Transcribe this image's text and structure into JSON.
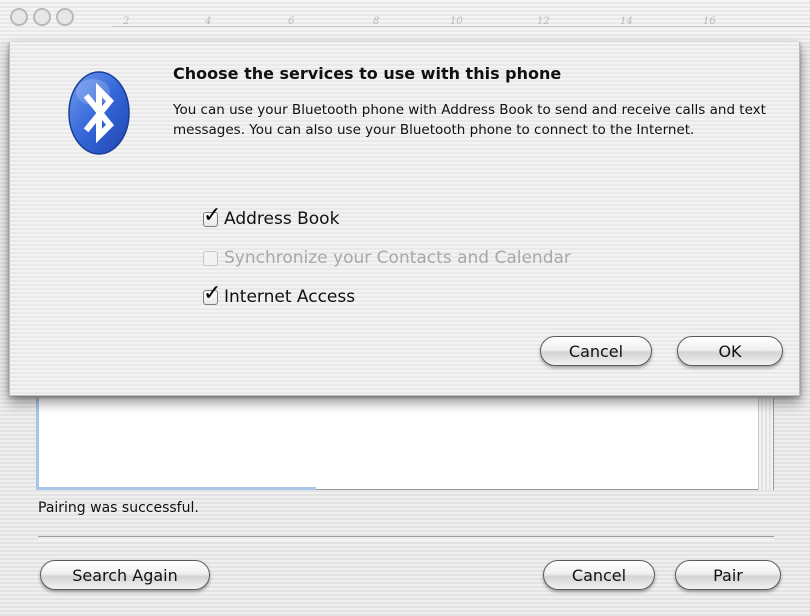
{
  "background_window": {
    "ruler_numbers": [
      "2",
      "4",
      "6",
      "8",
      "10",
      "12",
      "14",
      "16"
    ],
    "status_text": "Pairing was successful.",
    "buttons": {
      "search_again": "Search Again",
      "cancel": "Cancel",
      "pair": "Pair"
    }
  },
  "sheet": {
    "title": "Choose the services to use with this phone",
    "description": "You can use your Bluetooth phone with Address Book to send and receive calls and text messages.  You can also use your Bluetooth phone to connect to the Internet.",
    "options": [
      {
        "label": "Address Book",
        "checked": true,
        "enabled": true
      },
      {
        "label": "Synchronize your Contacts and Calendar",
        "checked": false,
        "enabled": false
      },
      {
        "label": "Internet Access",
        "checked": true,
        "enabled": true
      }
    ],
    "buttons": {
      "cancel": "Cancel",
      "ok": "OK"
    },
    "icon": "bluetooth-icon",
    "accent_color": "#2f5fd0"
  }
}
